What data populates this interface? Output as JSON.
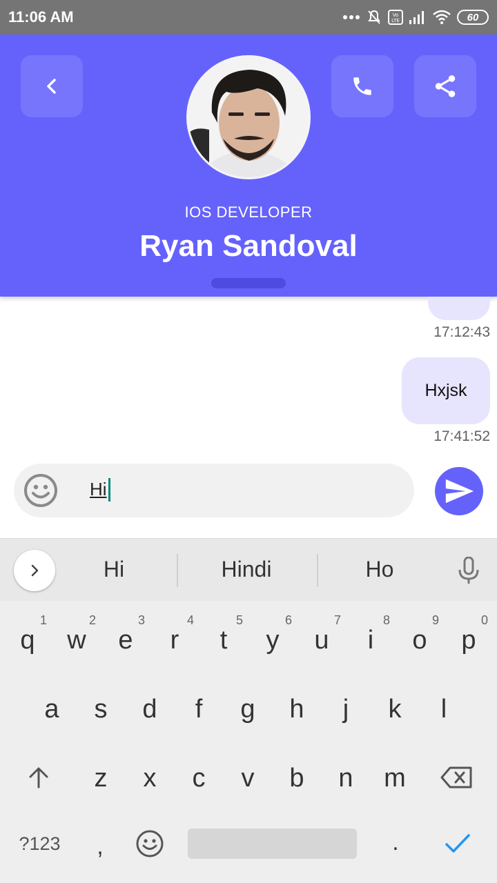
{
  "status_bar": {
    "time": "11:06 AM",
    "battery": "60"
  },
  "header": {
    "role": "IOS DEVELOPER",
    "name": "Ryan Sandoval",
    "accent_color": "#6562fc"
  },
  "messages": [
    {
      "text": "",
      "time": "17:12:43",
      "sender": "me"
    },
    {
      "text": "Hxjsk",
      "time": "17:41:52",
      "sender": "me"
    }
  ],
  "composer": {
    "value": "Hi"
  },
  "keyboard": {
    "suggestions": [
      "Hi",
      "Hindi",
      "Ho"
    ],
    "row1": [
      {
        "l": "q",
        "n": "1"
      },
      {
        "l": "w",
        "n": "2"
      },
      {
        "l": "e",
        "n": "3"
      },
      {
        "l": "r",
        "n": "4"
      },
      {
        "l": "t",
        "n": "5"
      },
      {
        "l": "y",
        "n": "6"
      },
      {
        "l": "u",
        "n": "7"
      },
      {
        "l": "i",
        "n": "8"
      },
      {
        "l": "o",
        "n": "9"
      },
      {
        "l": "p",
        "n": "0"
      }
    ],
    "row2": [
      "a",
      "s",
      "d",
      "f",
      "g",
      "h",
      "j",
      "k",
      "l"
    ],
    "row3": [
      "z",
      "x",
      "c",
      "v",
      "b",
      "n",
      "m"
    ],
    "symbols_label": "?123",
    "comma": ",",
    "period": "."
  }
}
